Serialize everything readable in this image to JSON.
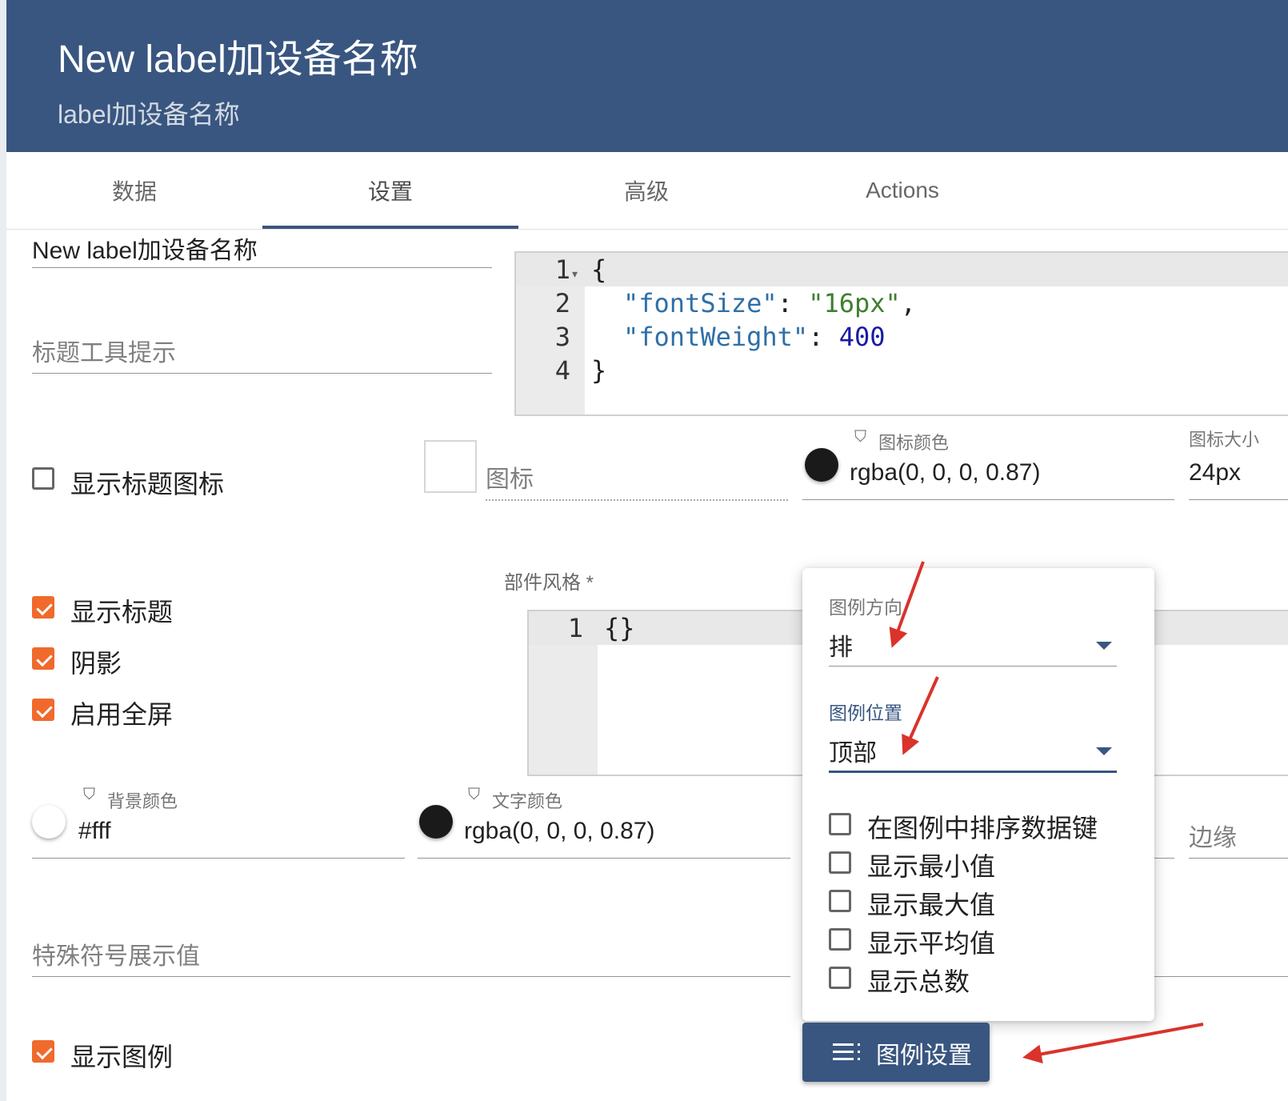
{
  "header": {
    "title": "New label加设备名称",
    "subtitle": "label加设备名称"
  },
  "tabs": [
    {
      "label": "数据",
      "active": false
    },
    {
      "label": "设置",
      "active": true
    },
    {
      "label": "高级",
      "active": false
    },
    {
      "label": "Actions",
      "active": false
    }
  ],
  "title_field": {
    "value": "New label加设备名称"
  },
  "tooltip_field": {
    "placeholder": "标题工具提示"
  },
  "title_style_editor": {
    "line_numbers": [
      "1",
      "2",
      "3",
      "4"
    ],
    "lines": [
      "{",
      "  \"fontSize\": \"16px\",",
      "  \"fontWeight\": 400",
      "}"
    ],
    "tokens": {
      "open": "{",
      "key1": "\"fontSize\"",
      "colon1": ": ",
      "val1": "\"16px\"",
      "comma": ",",
      "key2": "\"fontWeight\"",
      "colon2": ": ",
      "val2": "400",
      "close": "}"
    }
  },
  "show_title_icon": {
    "label": "显示标题图标",
    "checked": false
  },
  "icon_field": {
    "placeholder": "图标"
  },
  "icon_color": {
    "label": "图标颜色",
    "value": "rgba(0, 0, 0, 0.87)",
    "swatch": "#1a1a1a"
  },
  "icon_size": {
    "label": "图标大小",
    "value": "24px"
  },
  "widget_style": {
    "label": "部件风格 *",
    "line_numbers": [
      "1"
    ],
    "content": "{}"
  },
  "checkboxes": [
    {
      "label": "显示标题",
      "checked": true
    },
    {
      "label": "阴影",
      "checked": true
    },
    {
      "label": "启用全屏",
      "checked": true
    }
  ],
  "background_color": {
    "label": "背景颜色",
    "value": "#fff",
    "swatch": "#ffffff"
  },
  "text_color": {
    "label": "文字颜色",
    "value": "rgba(0, 0, 0, 0.87)",
    "swatch": "#1a1a1a"
  },
  "margin_field": {
    "placeholder": "边缘"
  },
  "special_symbol_field": {
    "placeholder": "特殊符号展示值"
  },
  "show_legend": {
    "label": "显示图例",
    "checked": true
  },
  "legend_popup": {
    "direction": {
      "label": "图例方向",
      "value": "排"
    },
    "position": {
      "label": "图例位置",
      "value": "顶部"
    },
    "options": [
      {
        "label": "在图例中排序数据键",
        "checked": false
      },
      {
        "label": "显示最小值",
        "checked": false
      },
      {
        "label": "显示最大值",
        "checked": false
      },
      {
        "label": "显示平均值",
        "checked": false
      },
      {
        "label": "显示总数",
        "checked": false
      }
    ]
  },
  "legend_settings_button": {
    "label": "图例设置",
    "icon": "list-settings-icon"
  },
  "colors": {
    "primary": "#395680",
    "checkbox": "#f06a2c",
    "annotation_arrow": "#d9332b"
  }
}
